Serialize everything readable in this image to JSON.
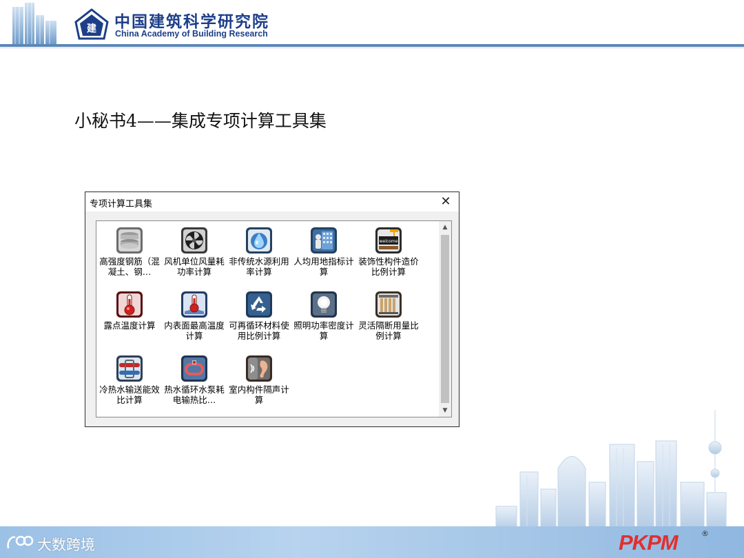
{
  "header": {
    "org_name_cn": "中国建筑科学研究院",
    "org_name_en": "China Academy of Building Research"
  },
  "slide": {
    "title": "小秘书4——集成专项计算工具集"
  },
  "dialog": {
    "title": "专项计算工具集",
    "close_glyph": "✕",
    "scroll_up_glyph": "▲",
    "scroll_down_glyph": "▼",
    "tools": [
      {
        "label": "高强度钢筋（混凝土、钢…",
        "icon": "steel-bars-icon"
      },
      {
        "label": "风机单位风量耗功率计算",
        "icon": "fan-icon"
      },
      {
        "label": "非传统水源利用率计算",
        "icon": "water-drop-icon"
      },
      {
        "label": "人均用地指标计算",
        "icon": "person-building-icon"
      },
      {
        "label": "装饰性构件造价比例计算",
        "icon": "welcome-sign-icon"
      },
      {
        "label": "露点温度计算",
        "icon": "thermometer-icon"
      },
      {
        "label": "内表面最高温度计算",
        "icon": "thermometer-book-icon"
      },
      {
        "label": "可再循环材料使用比例计算",
        "icon": "recycle-icon"
      },
      {
        "label": "照明功率密度计算",
        "icon": "light-bulb-icon"
      },
      {
        "label": "灵活隔断用量比例计算",
        "icon": "partition-icon"
      },
      {
        "label": "冷热水输送能效比计算",
        "icon": "pipe-icon"
      },
      {
        "label": "热水循环水泵耗电输热比…",
        "icon": "pump-loop-icon"
      },
      {
        "label": "室内构件隔声计算",
        "icon": "ear-icon"
      }
    ]
  },
  "footer": {
    "watermark_text": "大数跨境",
    "brand": "PKPM",
    "brand_registered": "®"
  },
  "colors": {
    "header_rule": "#5b86b8",
    "org_text": "#1d3f8a",
    "footer_band": "#a5c6e7",
    "brand_red": "#e03030"
  }
}
